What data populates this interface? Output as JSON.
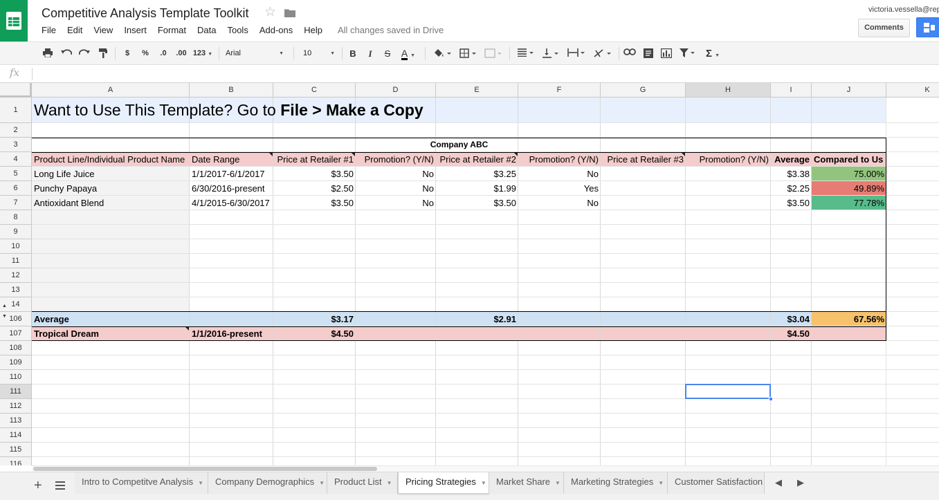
{
  "app": {
    "title": "Competitive Analysis Template Toolkit",
    "save_status": "All changes saved in Drive",
    "user_email": "victoria.vessella@rep",
    "comments_label": "Comments",
    "menu": [
      "File",
      "Edit",
      "View",
      "Insert",
      "Format",
      "Data",
      "Tools",
      "Add-ons",
      "Help"
    ]
  },
  "toolbar": {
    "currency": "$",
    "percent": "%",
    "decimal_decrease": ".0",
    "decimal_increase": ".00",
    "more_formats": "123",
    "font": "Arial",
    "font_size": "10",
    "bold": "B",
    "italic": "I",
    "strike": "S",
    "text_color": "A",
    "functions": "Σ"
  },
  "formula_bar": {
    "icon": "fx",
    "value": ""
  },
  "columns": [
    "A",
    "B",
    "C",
    "D",
    "E",
    "F",
    "G",
    "H",
    "I",
    "J",
    "K"
  ],
  "rows": [
    "1",
    "2",
    "3",
    "4",
    "5",
    "6",
    "7",
    "8",
    "9",
    "10",
    "11",
    "12",
    "13",
    "14",
    "106",
    "107",
    "108",
    "109",
    "110",
    "111",
    "112",
    "113",
    "114",
    "115",
    "116"
  ],
  "sheet": {
    "title_plain": "Want to Use This Template? Go to ",
    "title_bold": "File > Make a Copy",
    "company": "Company ABC",
    "headers": [
      "Product Line/Individual Product Name",
      "Date Range",
      "Price at Retailer #1",
      "Promotion? (Y/N)",
      "Price at Retailer #2",
      "Promotion? (Y/N)",
      "Price at Retailer #3",
      "Promotion? (Y/N)",
      "Average",
      "Compared to Us"
    ],
    "products": [
      {
        "name": "Long Life Juice",
        "date": "1/1/2017-6/1/2017",
        "p1": "$3.50",
        "promo1": "No",
        "p2": "$3.25",
        "promo2": "No",
        "avg": "$3.38",
        "cmp": "75.00%",
        "cmp_color": "#93c47d"
      },
      {
        "name": "Punchy Papaya",
        "date": "6/30/2016-present",
        "p1": "$2.50",
        "promo1": "No",
        "p2": "$1.99",
        "promo2": "Yes",
        "avg": "$2.25",
        "cmp": "49.89%",
        "cmp_color": "#e67c73"
      },
      {
        "name": "Antioxidant Blend",
        "date": "4/1/2015-6/30/2017",
        "p1": "$3.50",
        "promo1": "No",
        "p2": "$3.50",
        "promo2": "No",
        "avg": "$3.50",
        "cmp": "77.78%",
        "cmp_color": "#57bb8a"
      }
    ],
    "average_row": {
      "label": "Average",
      "p1": "$3.17",
      "p2": "$2.91",
      "avg": "$3.04",
      "cmp": "67.56%"
    },
    "ours_row": {
      "label": "Tropical Dream",
      "date": "1/1/2016-present",
      "p1": "$4.50",
      "avg": "$4.50"
    }
  },
  "tabs": [
    "Intro to Competitve Analysis",
    "Company Demographics",
    "Product List",
    "Pricing Strategies",
    "Market Share",
    "Marketing Strategies",
    "Customer Satisfaction"
  ],
  "active_tab": "Pricing Strategies",
  "colors": {
    "brand_green": "#0f9d58",
    "header_pink": "#f4cccc",
    "average_blue": "#cfe2f3",
    "highlight_orange": "#f6c26b",
    "title_blue": "#e8f0fe",
    "selection": "#4a86e8"
  }
}
